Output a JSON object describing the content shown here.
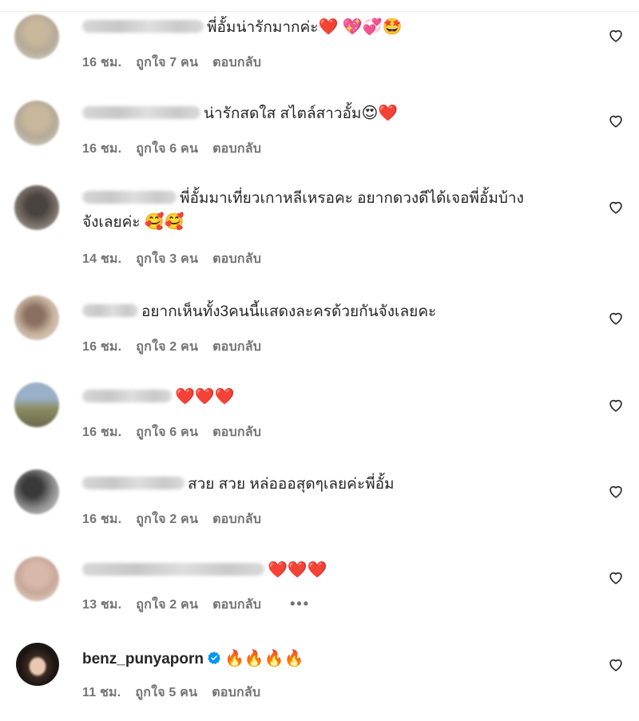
{
  "comments": [
    {
      "text": "พี่อั้มน่ารักมากค่ะ",
      "emojis": "❤️ 💖💞🤩",
      "time": "16 ชม.",
      "likes": "ถูกใจ 7 คน",
      "reply": "ตอบกลับ"
    },
    {
      "text": "น่ารักสดใส สไตล์สาวอั้ม",
      "emojis": "😍❤️",
      "time": "16 ชม.",
      "likes": "ถูกใจ 6 คน",
      "reply": "ตอบกลับ"
    },
    {
      "text": "พี่อั้มมาเที่ยวเกาหลีเหรอคะ อยากดวงดีได้เจอพี่อั้มบ้าง",
      "text2": "จังเลยค่ะ",
      "emojis": "🥰🥰",
      "time": "14 ชม.",
      "likes": "ถูกใจ 3 คน",
      "reply": "ตอบกลับ"
    },
    {
      "text": "อยากเห็นทั้ง3คนนี้แสดงละครด้วยกันจังเลยคะ",
      "emojis": "",
      "time": "16 ชม.",
      "likes": "ถูกใจ 2 คน",
      "reply": "ตอบกลับ"
    },
    {
      "text": "",
      "emojis": "❤️❤️❤️",
      "time": "16 ชม.",
      "likes": "ถูกใจ 6 คน",
      "reply": "ตอบกลับ"
    },
    {
      "text": "สวย สวย หล่อออสุดๆเลยค่ะพี่อั้ม",
      "emojis": "",
      "time": "16 ชม.",
      "likes": "ถูกใจ 2 คน",
      "reply": "ตอบกลับ"
    },
    {
      "text": "",
      "emojis": "❤️❤️❤️",
      "time": "13 ชม.",
      "likes": "ถูกใจ 2 คน",
      "reply": "ตอบกลับ",
      "more": "•••"
    },
    {
      "username": "benz_punyaporn",
      "text": "",
      "emojis": "🔥🔥🔥🔥",
      "time": "11 ชม.",
      "likes": "ถูกใจ 5 คน",
      "reply": "ตอบกลับ"
    }
  ],
  "icons": {
    "like": "heart-outline-icon",
    "verified": "verified-badge-icon"
  },
  "colors": {
    "text": "#262626",
    "secondary": "#737373",
    "verified": "#0095f6"
  }
}
